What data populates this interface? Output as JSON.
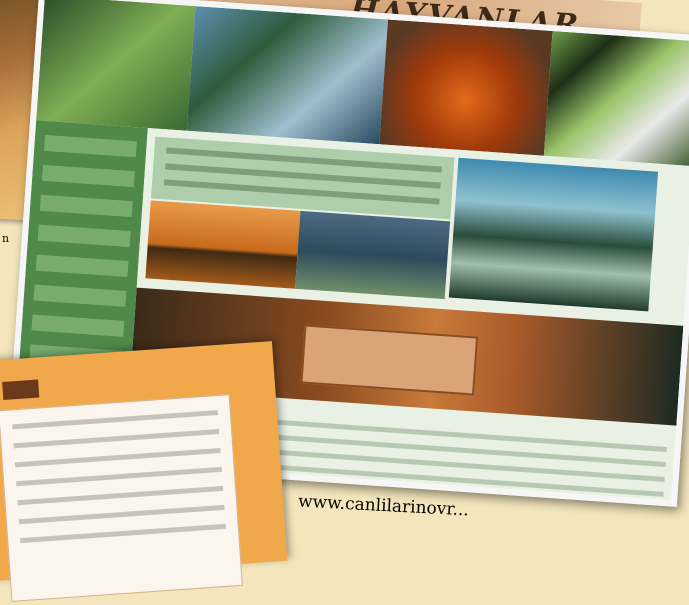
{
  "magazine": {
    "logo_text": "HAYVANLAR"
  },
  "caption_left": "n",
  "url_caption": "www.canlilarinovr...",
  "colors": {
    "background": "#f3e6bc",
    "site_green": "#4f8a4a",
    "page_orange": "#f0a84b"
  }
}
